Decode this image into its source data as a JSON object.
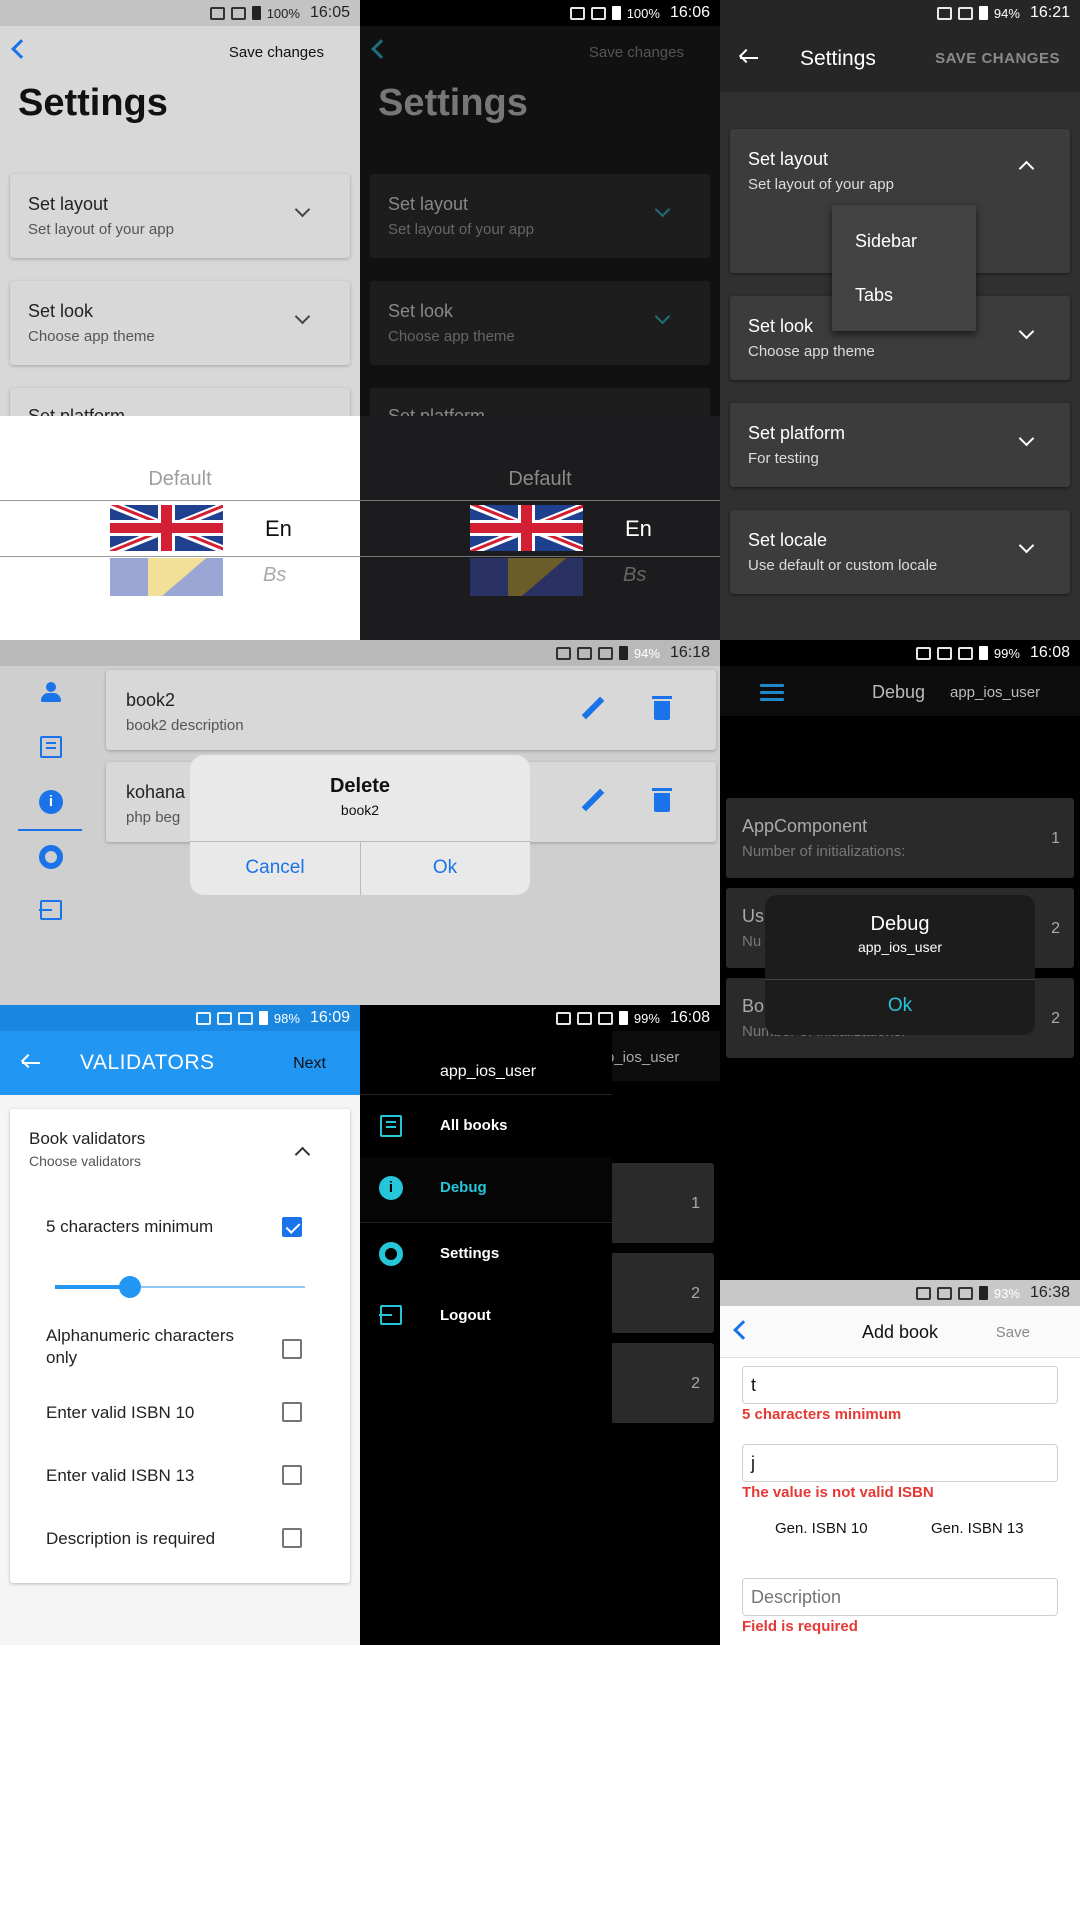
{
  "colors": {
    "primary": "#1a73e8",
    "validators_bar": "#2196f3",
    "teal": "#26c6da",
    "dark_bg": "#000000",
    "dark_card": "#2a2a2a",
    "error": "#e53935"
  },
  "settings_light": {
    "status": {
      "battery": "100%",
      "time": "16:05"
    },
    "save": "Save changes",
    "title": "Settings",
    "items": [
      {
        "title": "Set layout",
        "subtitle": "Set layout of your app"
      },
      {
        "title": "Set look",
        "subtitle": "Choose app theme"
      },
      {
        "title": "Set platform"
      }
    ],
    "picker": {
      "default": "Default",
      "en": "En",
      "bs": "Bs"
    }
  },
  "settings_dark": {
    "status": {
      "battery": "100%",
      "time": "16:06"
    },
    "save": "Save changes",
    "title": "Settings",
    "items": [
      {
        "title": "Set layout",
        "subtitle": "Set layout of your app"
      },
      {
        "title": "Set look",
        "subtitle": "Choose app theme"
      },
      {
        "title": "Set platform"
      }
    ],
    "picker": {
      "default": "Default",
      "en": "En",
      "bs": "Bs"
    }
  },
  "settings_material": {
    "status": {
      "battery": "94%",
      "time": "16:21"
    },
    "title": "Settings",
    "save": "SAVE CHANGES",
    "items": [
      {
        "title": "Set layout",
        "subtitle": "Set layout of your app"
      },
      {
        "title": "Set look",
        "subtitle": "Choose app theme"
      },
      {
        "title": "Set platform",
        "subtitle": "For testing"
      },
      {
        "title": "Set locale",
        "subtitle": "Use default or custom locale"
      }
    ],
    "dropdown": [
      "Sidebar",
      "Tabs"
    ]
  },
  "books": {
    "status": {
      "battery": "94%",
      "time": "16:18"
    },
    "rows": [
      {
        "title": "book2",
        "description": "book2 description"
      },
      {
        "title": "kohana",
        "description": "php beg"
      }
    ],
    "dialog": {
      "title": "Delete",
      "message": "book2",
      "cancel": "Cancel",
      "ok": "Ok"
    }
  },
  "debug": {
    "status": {
      "battery": "99%",
      "time": "16:08"
    },
    "title": "Debug",
    "user": "app_ios_user",
    "rows": [
      {
        "title": "AppComponent",
        "subtitle": "Number of initializations:",
        "count": "1"
      },
      {
        "title": "Us",
        "subtitle": "Nu",
        "count": "2"
      },
      {
        "title": "Bo",
        "subtitle": "Number of initializations:",
        "count": "2"
      }
    ],
    "dialog": {
      "title": "Debug",
      "message": "app_ios_user",
      "ok": "Ok"
    }
  },
  "validators": {
    "status": {
      "battery": "98%",
      "time": "16:09"
    },
    "title": "VALIDATORS",
    "next": "Next",
    "section_title": "Book validators",
    "section_subtitle": "Choose validators",
    "slider_value": 0.28,
    "options": [
      {
        "label": "5 characters minimum",
        "checked": true
      },
      {
        "label": "Alphanumeric characters only",
        "checked": false
      },
      {
        "label": "Enter valid ISBN 10",
        "checked": false
      },
      {
        "label": "Enter valid ISBN 13",
        "checked": false
      },
      {
        "label": "Description is required",
        "checked": false
      }
    ]
  },
  "drawer": {
    "status": {
      "battery": "99%",
      "time": "16:08"
    },
    "user": "app_ios_user",
    "behind_title": "o_ios_user",
    "behind_counts": [
      "1",
      "2",
      "2"
    ],
    "items": [
      {
        "label": "All books",
        "icon": "books-icon"
      },
      {
        "label": "Debug",
        "icon": "info-icon"
      },
      {
        "label": "Settings",
        "icon": "gear-icon"
      },
      {
        "label": "Logout",
        "icon": "logout-icon"
      }
    ]
  },
  "add_book": {
    "status": {
      "battery": "93%",
      "time": "16:38"
    },
    "title": "Add book",
    "save": "Save",
    "title_value": "t",
    "title_error": "5 characters minimum",
    "isbn_value": "j",
    "isbn_error": "The value is not valid ISBN",
    "gen10": "Gen. ISBN 10",
    "gen13": "Gen. ISBN 13",
    "description_placeholder": "Description",
    "description_error": "Field is required"
  }
}
